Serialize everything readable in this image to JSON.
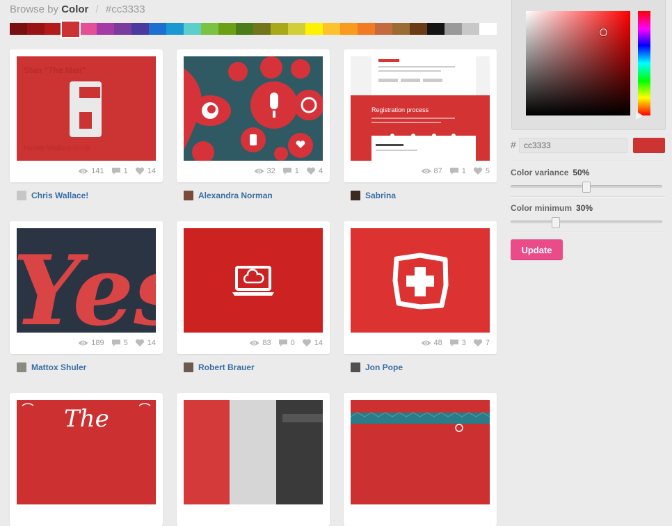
{
  "breadcrumb": {
    "prefix": "Browse by",
    "strong": "Color",
    "separator": "/",
    "hex": "#cc3333"
  },
  "swatches": [
    "#7a0f10",
    "#991315",
    "#b51a1a",
    "#cc3333",
    "#e35098",
    "#a43ba4",
    "#7a3a9e",
    "#4a3aa0",
    "#1d6fd0",
    "#1a98d2",
    "#5dcfcb",
    "#7cc242",
    "#6aa011",
    "#4a7d1a",
    "#72751a",
    "#a8a818",
    "#d0cf38",
    "#fff200",
    "#fdc22c",
    "#f99b1c",
    "#f17a23",
    "#c56a3c",
    "#9c6b34",
    "#6b3b13",
    "#141414",
    "#999999",
    "#c8c8c8",
    "#ffffff"
  ],
  "selected_swatch": "#cc3333",
  "shots": [
    {
      "author": "Chris Wallace!",
      "views": "141",
      "comments": "1",
      "likes": "14",
      "kind": "number-six",
      "thumb_text": "Stan \"The Man\"",
      "thumb_foot": "Hunter-Wallace-Knob",
      "avatar": "#c6c6c6"
    },
    {
      "author": "Alexandra Norman",
      "views": "32",
      "comments": "1",
      "likes": "4",
      "kind": "pattern",
      "avatar": "#7a4a3a"
    },
    {
      "author": "Sabrina",
      "views": "87",
      "comments": "1",
      "likes": "5",
      "kind": "form",
      "thumb_text": "Registration process",
      "avatar": "#3a2a20"
    },
    {
      "author": "Mattox Shuler",
      "views": "189",
      "comments": "5",
      "likes": "14",
      "kind": "yes",
      "thumb_text": "Yes",
      "avatar": "#8a8a80"
    },
    {
      "author": "Robert Brauer",
      "views": "83",
      "comments": "0",
      "likes": "14",
      "kind": "laptop",
      "avatar": "#6a5a50"
    },
    {
      "author": "Jon Pope",
      "views": "48",
      "comments": "3",
      "likes": "7",
      "kind": "cross",
      "avatar": "#505050"
    },
    {
      "kind": "the",
      "thumb_text": "The"
    },
    {
      "kind": "blocks"
    },
    {
      "kind": "teal-stripe"
    }
  ],
  "picker": {
    "hex_label": "#",
    "hex_value": "cc3333",
    "preview_color": "#cc3333"
  },
  "sliders": [
    {
      "label": "Color variance",
      "value": "50%",
      "level": 0.5
    },
    {
      "label": "Color minimum",
      "value": "30%",
      "level": 0.3
    }
  ],
  "update_label": "Update",
  "colors": {
    "accent_pink": "#ea4c89",
    "link_blue": "#3a6ea5",
    "shot_red": "#cc3333"
  }
}
